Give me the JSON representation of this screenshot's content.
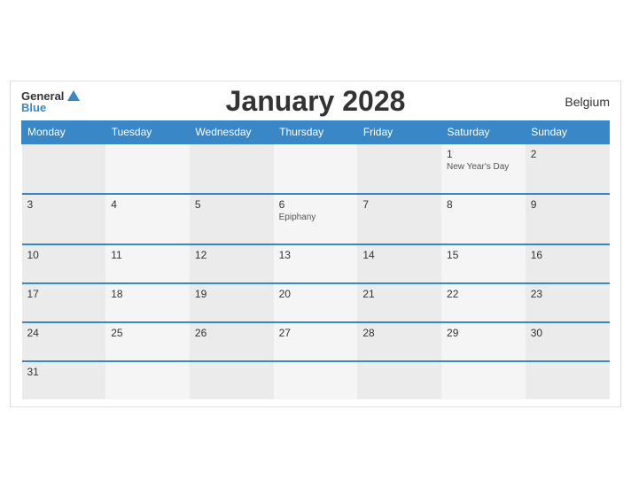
{
  "header": {
    "title": "January 2028",
    "country": "Belgium",
    "logo_general": "General",
    "logo_blue": "Blue"
  },
  "weekdays": [
    "Monday",
    "Tuesday",
    "Wednesday",
    "Thursday",
    "Friday",
    "Saturday",
    "Sunday"
  ],
  "weeks": [
    [
      {
        "day": "",
        "event": ""
      },
      {
        "day": "",
        "event": ""
      },
      {
        "day": "",
        "event": ""
      },
      {
        "day": "",
        "event": ""
      },
      {
        "day": "",
        "event": ""
      },
      {
        "day": "1",
        "event": "New Year's Day"
      },
      {
        "day": "2",
        "event": ""
      }
    ],
    [
      {
        "day": "3",
        "event": ""
      },
      {
        "day": "4",
        "event": ""
      },
      {
        "day": "5",
        "event": ""
      },
      {
        "day": "6",
        "event": "Epiphany"
      },
      {
        "day": "7",
        "event": ""
      },
      {
        "day": "8",
        "event": ""
      },
      {
        "day": "9",
        "event": ""
      }
    ],
    [
      {
        "day": "10",
        "event": ""
      },
      {
        "day": "11",
        "event": ""
      },
      {
        "day": "12",
        "event": ""
      },
      {
        "day": "13",
        "event": ""
      },
      {
        "day": "14",
        "event": ""
      },
      {
        "day": "15",
        "event": ""
      },
      {
        "day": "16",
        "event": ""
      }
    ],
    [
      {
        "day": "17",
        "event": ""
      },
      {
        "day": "18",
        "event": ""
      },
      {
        "day": "19",
        "event": ""
      },
      {
        "day": "20",
        "event": ""
      },
      {
        "day": "21",
        "event": ""
      },
      {
        "day": "22",
        "event": ""
      },
      {
        "day": "23",
        "event": ""
      }
    ],
    [
      {
        "day": "24",
        "event": ""
      },
      {
        "day": "25",
        "event": ""
      },
      {
        "day": "26",
        "event": ""
      },
      {
        "day": "27",
        "event": ""
      },
      {
        "day": "28",
        "event": ""
      },
      {
        "day": "29",
        "event": ""
      },
      {
        "day": "30",
        "event": ""
      }
    ],
    [
      {
        "day": "31",
        "event": ""
      },
      {
        "day": "",
        "event": ""
      },
      {
        "day": "",
        "event": ""
      },
      {
        "day": "",
        "event": ""
      },
      {
        "day": "",
        "event": ""
      },
      {
        "day": "",
        "event": ""
      },
      {
        "day": "",
        "event": ""
      }
    ]
  ]
}
